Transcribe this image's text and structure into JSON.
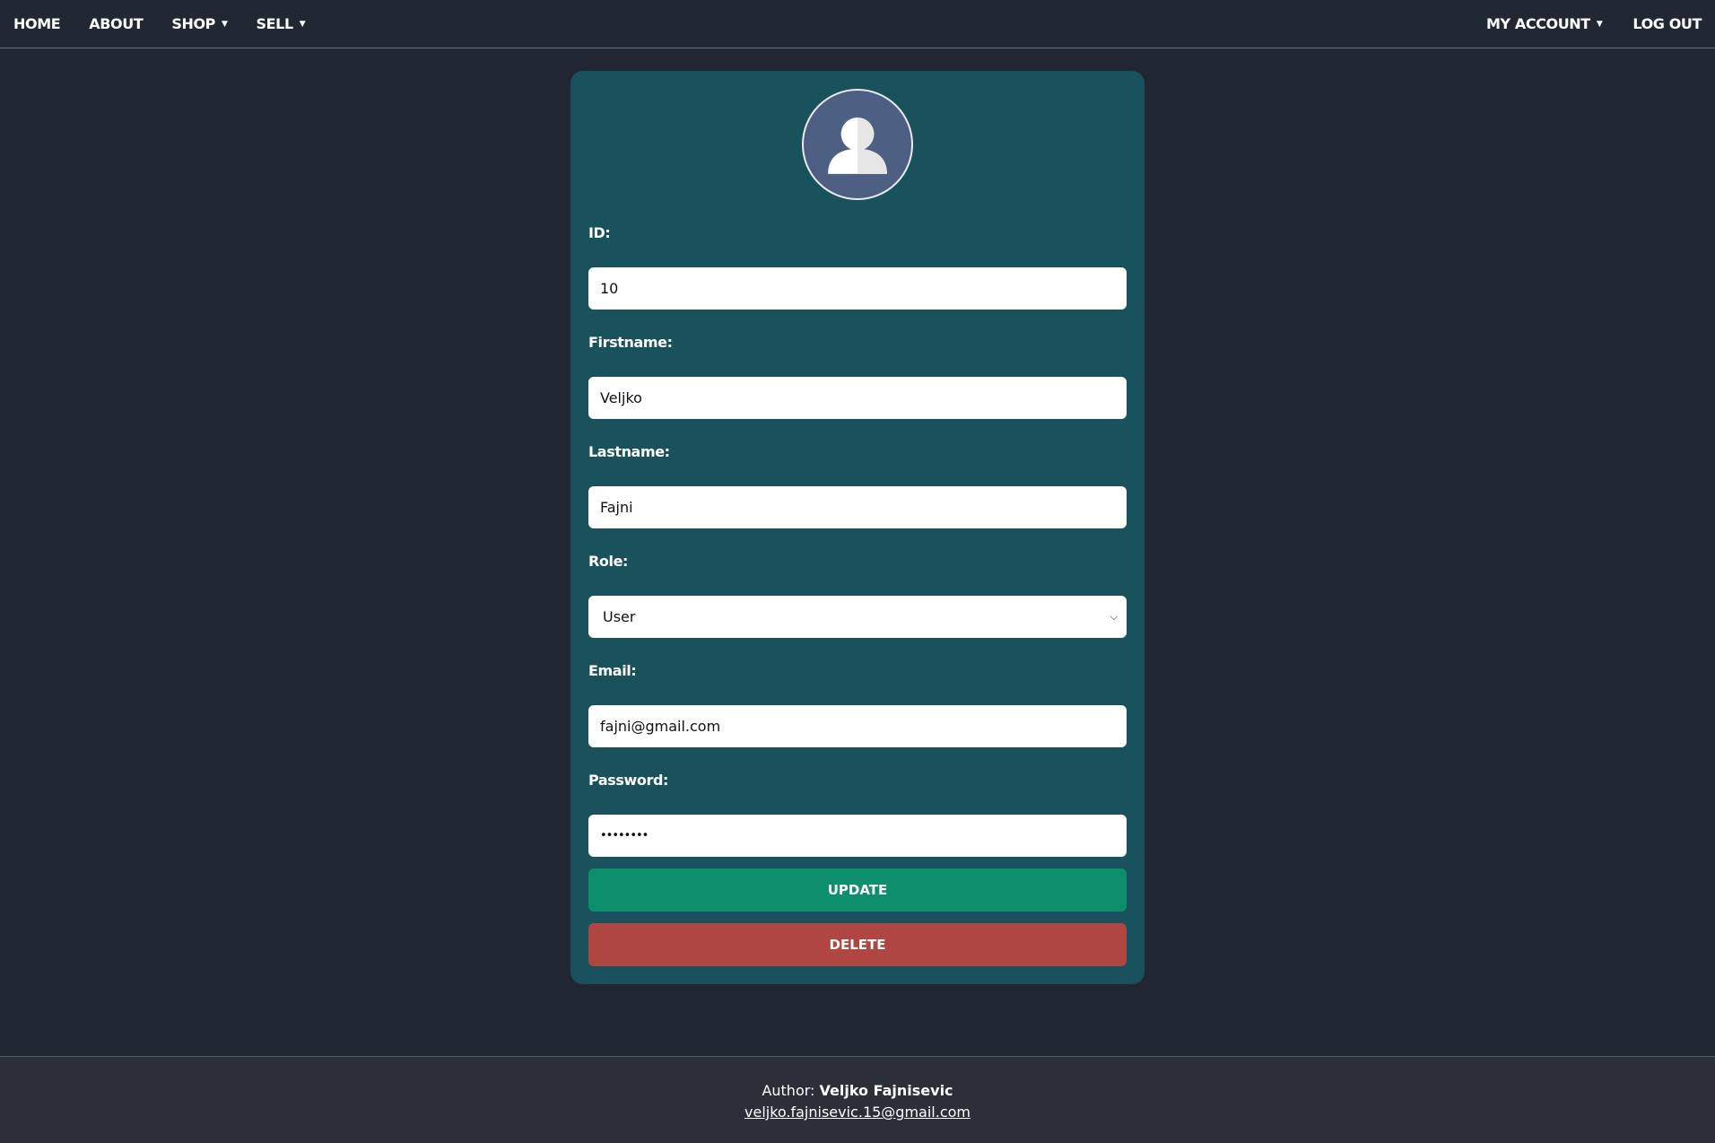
{
  "nav": {
    "home": "HOME",
    "about": "ABOUT",
    "shop": "SHOP",
    "sell": "SELL",
    "my_account": "MY ACCOUNT",
    "log_out": "LOG OUT"
  },
  "form": {
    "id_label": "ID:",
    "id_value": "10",
    "firstname_label": "Firstname:",
    "firstname_value": "Veljko",
    "lastname_label": "Lastname:",
    "lastname_value": "Fajni",
    "role_label": "Role:",
    "role_value": "User",
    "email_label": "Email:",
    "email_value": "fajni@gmail.com",
    "password_label": "Password:",
    "password_value": "••••••••",
    "update_label": "UPDATE",
    "delete_label": "DELETE"
  },
  "footer": {
    "author_prefix": "Author:",
    "author_name": "Veljko Fajnisevic",
    "email": "veljko.fajnisevic.15@gmail.com"
  },
  "colors": {
    "page_bg": "#212733",
    "card_bg": "#19525c",
    "avatar_bg": "#4d5f82",
    "update_btn": "#0d8f6c",
    "delete_btn": "#af4641",
    "footer_bg": "#2a2f39"
  },
  "icons": {
    "avatar": "user-silhouette-icon",
    "dropdown": "caret-down-icon"
  }
}
